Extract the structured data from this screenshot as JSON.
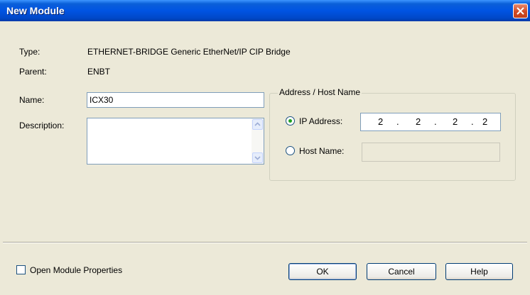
{
  "window": {
    "title": "New Module"
  },
  "info": {
    "type_label": "Type:",
    "type_value": "ETHERNET-BRIDGE Generic EtherNet/IP CIP Bridge",
    "parent_label": "Parent:",
    "parent_value": "ENBT"
  },
  "form": {
    "name_label": "Name:",
    "name_value": "ICX30",
    "description_label": "Description:",
    "description_value": ""
  },
  "address": {
    "group_label": "Address / Host Name",
    "ip_label": "IP Address:",
    "ip_octets": [
      "2",
      "2",
      "2",
      "2"
    ],
    "ip_dots": [
      ".",
      ".",
      "."
    ],
    "host_label": "Host Name:",
    "host_value": "",
    "selected": "ip"
  },
  "footer": {
    "open_properties_label": "Open Module Properties",
    "open_properties_checked": false,
    "ok_label": "OK",
    "cancel_label": "Cancel",
    "help_label": "Help"
  },
  "colors": {
    "titlebar": "#0054e3",
    "dialog_bg": "#ece9d8",
    "close_button": "#d04a24"
  },
  "icons": {
    "close": "close-icon",
    "scroll_up": "scroll-up-arrow-icon",
    "scroll_down": "scroll-down-arrow-icon"
  }
}
